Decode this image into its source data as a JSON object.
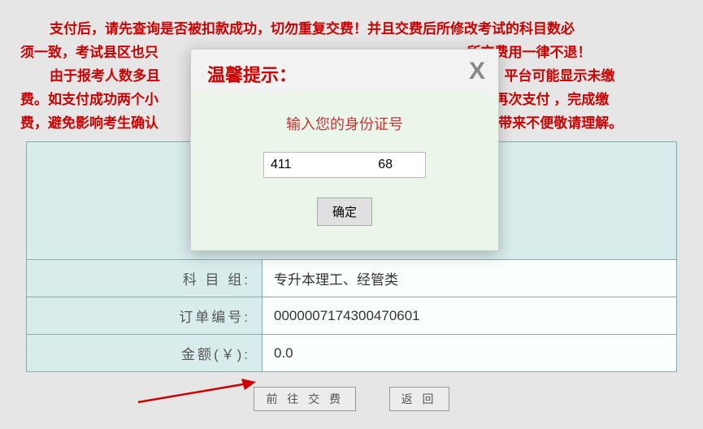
{
  "notice": {
    "line1a": "支付后，请先查询是否被扣款成功，切勿重复交费！并且交费后所修改考试的科目数必",
    "line1b": "须一致，考试县区也只",
    "line1c": "所交费用一律不退！",
    "line2a": "由于报考人数多且",
    "line2b": "后，平台可能显示未缴",
    "line3a": "费。如支付成功两个小",
    "line3b": "亍卡再次支付 ，完成缴",
    "line4a": "费，避免影响考生确认",
    "line4b": "度。 带来不便敬请理解。"
  },
  "table": {
    "subject_label": "科 目 组:",
    "subject_val": "专升本理工、经管类",
    "order_label": "订单编号:",
    "order_val": "0000007174300470601",
    "amount_label": "金额(￥):",
    "amount_val": "0.0"
  },
  "buttons": {
    "pay": "前 往 交 费",
    "back": "返  回"
  },
  "modal": {
    "title": "温馨提示：",
    "close": "X",
    "message": "输入您的身份证号",
    "input_value": "411                        68",
    "confirm": "确定"
  }
}
